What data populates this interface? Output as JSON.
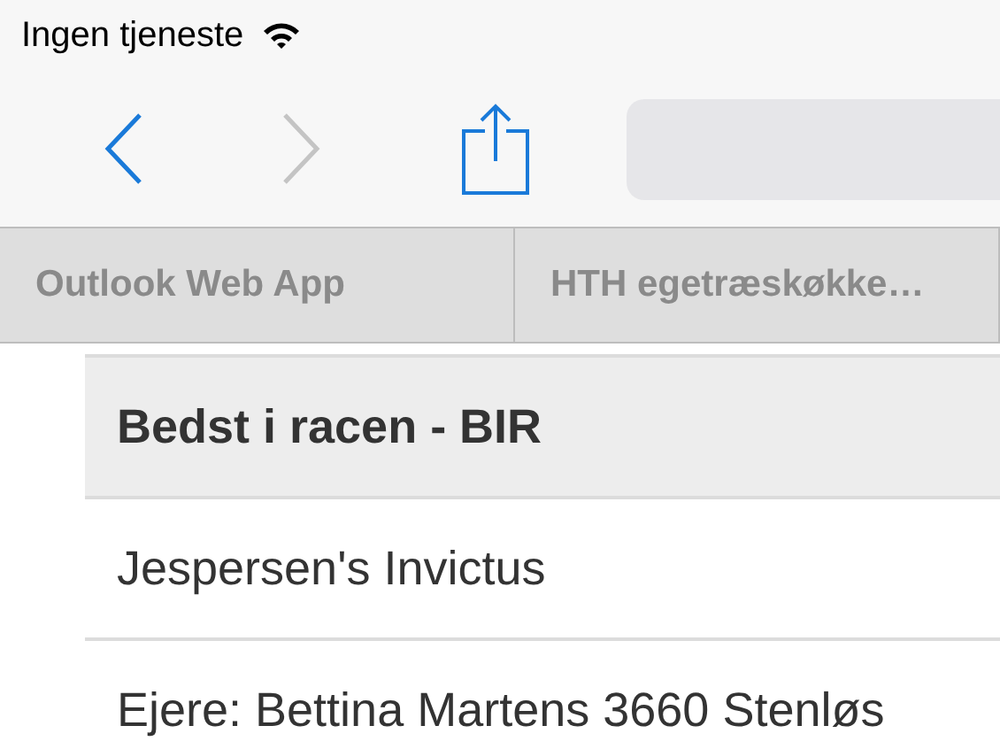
{
  "status_bar": {
    "carrier": "Ingen tjeneste"
  },
  "toolbar": {
    "back": {
      "disabled": false
    },
    "forward": {
      "disabled": true
    }
  },
  "tabs": [
    {
      "label": "Outlook Web App",
      "selected": false
    },
    {
      "label": "HTH egetræskøkke…",
      "selected": false
    }
  ],
  "table": {
    "rows": [
      {
        "kind": "header",
        "text": "Bedst i racen - BIR"
      },
      {
        "kind": "row",
        "text": "Jespersen's Invictus"
      },
      {
        "kind": "row",
        "text": "Ejere: Bettina Martens 3660 Stenløs"
      }
    ]
  }
}
